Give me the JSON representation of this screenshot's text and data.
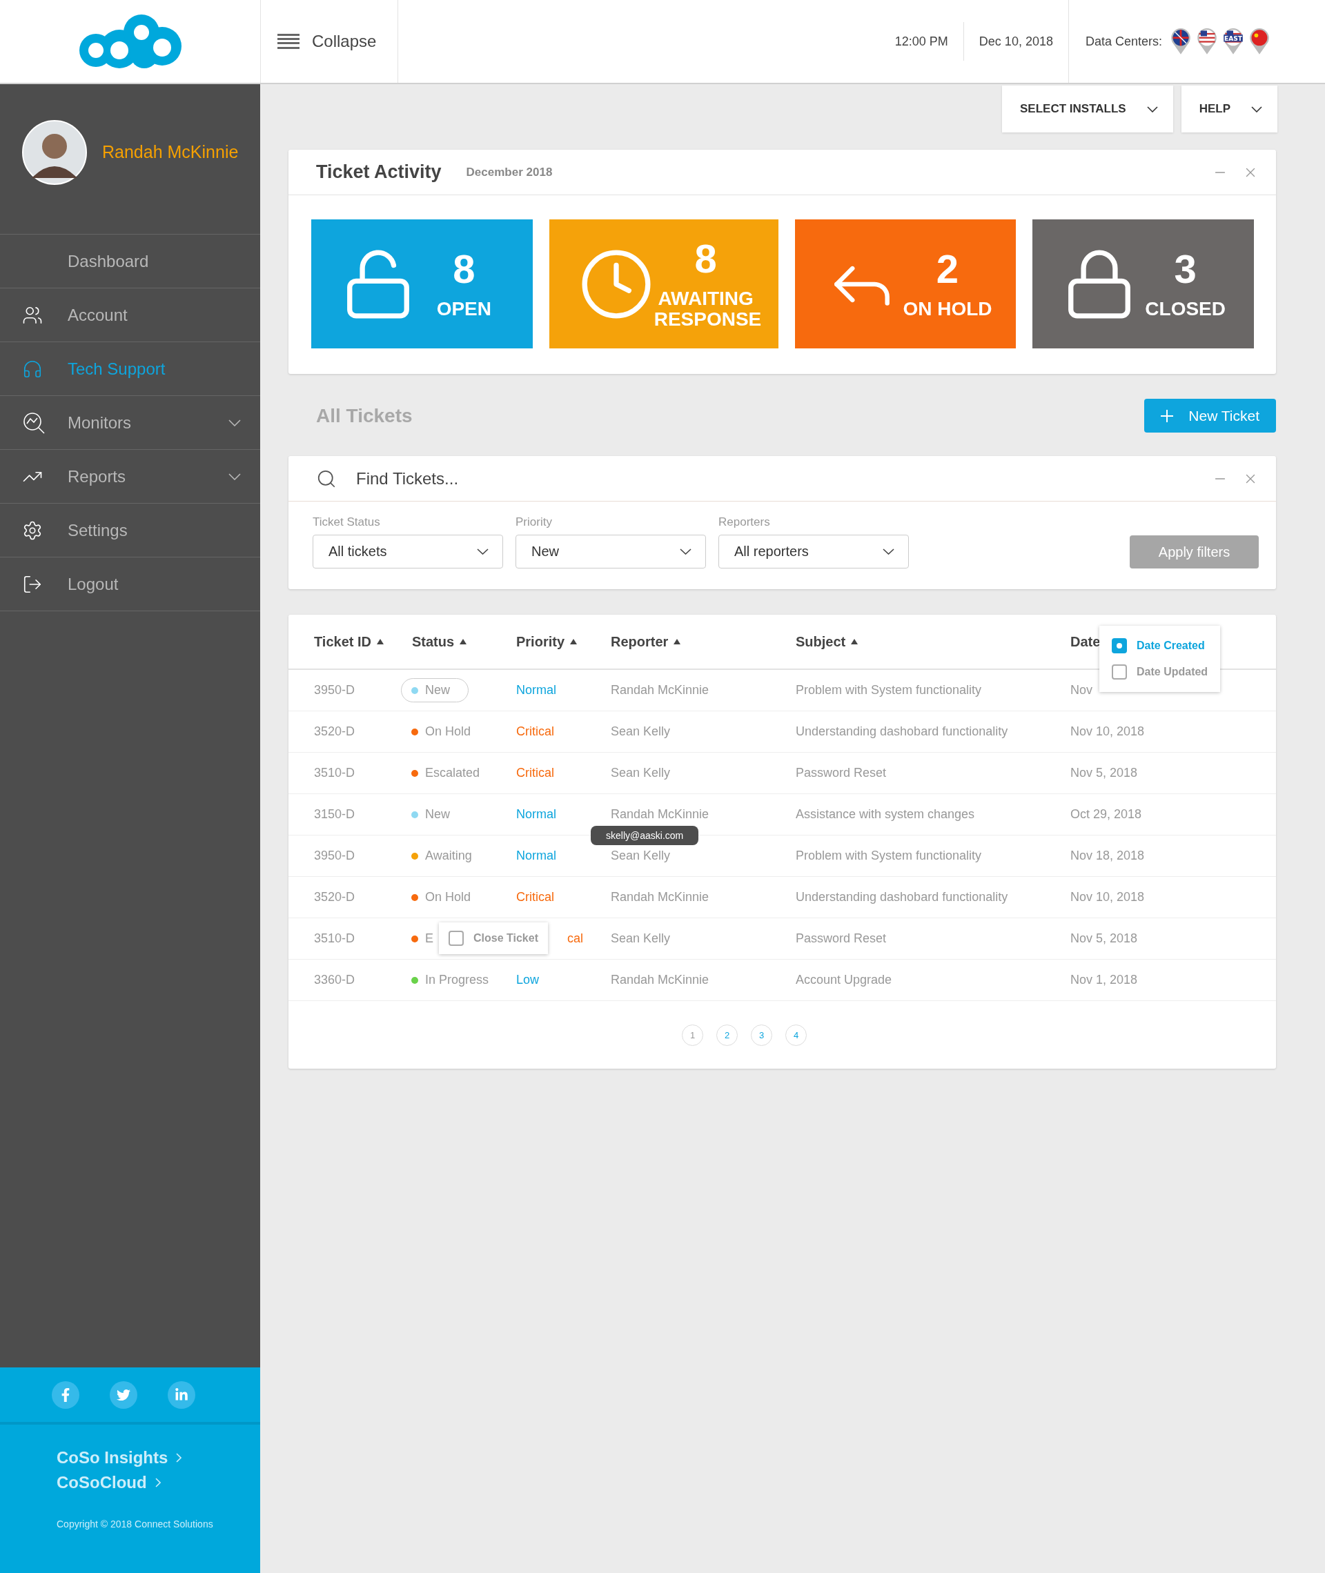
{
  "header": {
    "collapse_label": "Collapse",
    "time": "12:00 PM",
    "date": "Dec 10, 2018",
    "data_centers_label": "Data Centers:",
    "data_centers": [
      {
        "kind": "uk"
      },
      {
        "kind": "us"
      },
      {
        "kind": "us",
        "badge": "EAST"
      },
      {
        "kind": "cn"
      }
    ]
  },
  "sidebar": {
    "user_name": "Randah McKinnie",
    "items": [
      {
        "label": "Dashboard",
        "selected": false
      },
      {
        "label": "Account",
        "selected": false
      },
      {
        "label": "Tech Support",
        "selected": true
      },
      {
        "label": "Monitors",
        "selected": false,
        "expanded": false
      },
      {
        "label": "Reports",
        "selected": false,
        "expanded": false
      },
      {
        "label": "Settings",
        "selected": false
      },
      {
        "label": "Logout",
        "selected": false
      }
    ],
    "footer_links": [
      "CoSo Insights",
      "CoSoCloud"
    ],
    "copyright": "Copyright © 2018 Connect Solutions"
  },
  "toolbar": [
    "SELECT INSTALLS",
    "HELP"
  ],
  "activity": {
    "title": "Ticket Activity",
    "period": "December 2018",
    "tiles": [
      {
        "count": "8",
        "label": "OPEN",
        "color": "#0ea5dd"
      },
      {
        "count": "8",
        "label": "AWAITING RESPONSE",
        "color": "#f5a20a"
      },
      {
        "count": "2",
        "label": "ON HOLD",
        "color": "#f76a0e"
      },
      {
        "count": "3",
        "label": "CLOSED",
        "color": "#6a6766"
      }
    ]
  },
  "all_tickets": {
    "title": "All Tickets",
    "new_button": "New Ticket"
  },
  "search": {
    "placeholder": "Find Tickets..."
  },
  "filters": [
    {
      "label": "Ticket Status",
      "value": "All tickets"
    },
    {
      "label": "Priority",
      "value": "New"
    },
    {
      "label": "Reporters",
      "value": "All reporters"
    }
  ],
  "apply_button": "Apply filters",
  "table": {
    "columns": [
      "Ticket ID",
      "Status",
      "Priority",
      "Reporter",
      "Subject",
      "Date"
    ],
    "rows": [
      {
        "id": "3950-D",
        "status": {
          "label": "New",
          "color": "#8fd9f2"
        },
        "priority": {
          "label": "Normal",
          "color": "#0ea5dd"
        },
        "reporter": "Randah McKinnie",
        "subject": "Problem with System functionality",
        "date": "Nov",
        "selected": true
      },
      {
        "id": "3520-D",
        "status": {
          "label": "On Hold",
          "color": "#f76a0e"
        },
        "priority": {
          "label": "Critical",
          "color": "#f76a0e"
        },
        "reporter": "Sean Kelly",
        "subject": "Understanding dashobard functionality",
        "date": "Nov 10, 2018",
        "selected": false
      },
      {
        "id": "3510-D",
        "status": {
          "label": "Escalated",
          "color": "#f76a0e"
        },
        "priority": {
          "label": "Critical",
          "color": "#f76a0e"
        },
        "reporter": "Sean Kelly",
        "subject": "Password Reset",
        "date": "Nov 5, 2018",
        "selected": false
      },
      {
        "id": "3150-D",
        "status": {
          "label": "New",
          "color": "#8fd9f2"
        },
        "priority": {
          "label": "Normal",
          "color": "#0ea5dd"
        },
        "reporter": "Randah McKinnie",
        "subject": "Assistance with system changes",
        "date": "Oct 29, 2018",
        "selected": false
      },
      {
        "id": "3950-D",
        "status": {
          "label": "Awaiting",
          "color": "#f5a20a"
        },
        "priority": {
          "label": "Normal",
          "color": "#0ea5dd"
        },
        "reporter": "Sean Kelly",
        "subject": "Problem with System functionality",
        "date": "Nov 18, 2018",
        "selected": false,
        "tooltip": "skelly@aaski.com"
      },
      {
        "id": "3520-D",
        "status": {
          "label": "On Hold",
          "color": "#f76a0e"
        },
        "priority": {
          "label": "Critical",
          "color": "#f76a0e"
        },
        "reporter": "Randah McKinnie",
        "subject": "Understanding dashobard functionality",
        "date": "Nov 10, 2018",
        "selected": false
      },
      {
        "id": "3510-D",
        "status": {
          "label": "E",
          "color": "#f76a0e"
        },
        "priority": {
          "label": "cal",
          "color": "#f76a0e"
        },
        "reporter": "Sean Kelly",
        "subject": "Password Reset",
        "date": "Nov 5, 2018",
        "selected": false,
        "menu": {
          "label": "Close Ticket",
          "checked": false
        }
      },
      {
        "id": "3360-D",
        "status": {
          "label": "In Progress",
          "color": "#6ad24a"
        },
        "priority": {
          "label": "Low",
          "color": "#0ea5dd"
        },
        "reporter": "Randah McKinnie",
        "subject": "Account Upgrade",
        "date": "Nov 1, 2018",
        "selected": false
      }
    ],
    "date_menu": [
      {
        "label": "Date Created",
        "checked": true
      },
      {
        "label": "Date Updated",
        "checked": false
      }
    ]
  },
  "pagination": [
    {
      "label": "1",
      "selected": true
    },
    {
      "label": "2",
      "selected": false
    },
    {
      "label": "3",
      "selected": false
    },
    {
      "label": "4",
      "selected": false
    }
  ]
}
